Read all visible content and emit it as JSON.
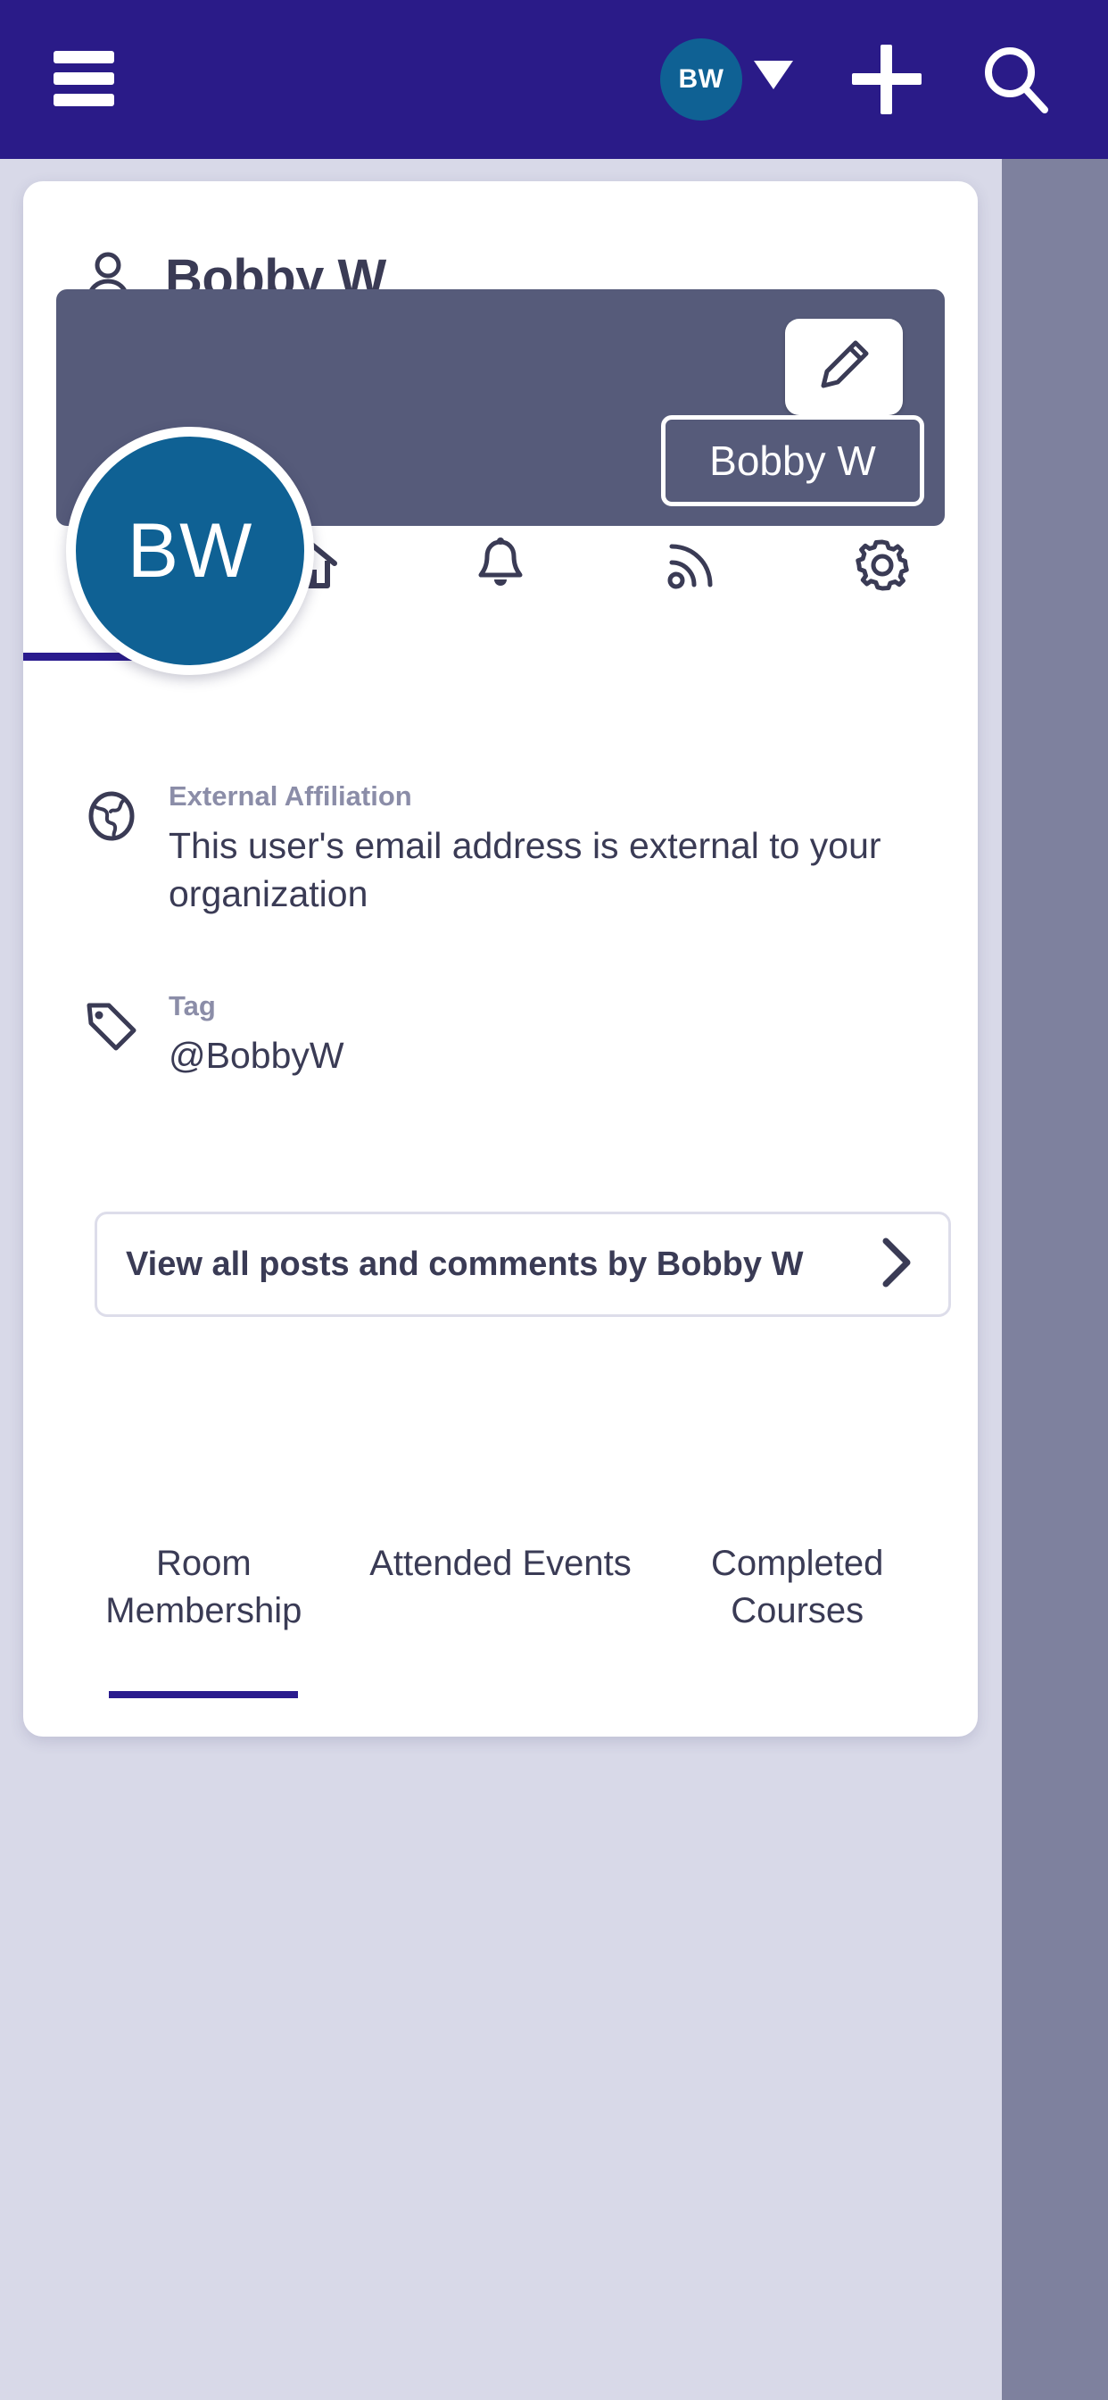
{
  "appbar": {
    "menu_icon": "hamburger-menu-icon",
    "avatar_initials": "BW",
    "caret_icon": "chevron-down-icon",
    "add_icon": "plus-icon",
    "search_icon": "search-icon",
    "background_color": "#2a1b88"
  },
  "card": {
    "title": "Bobby W",
    "title_icon": "person-icon",
    "icon_tabs": [
      {
        "name": "profile",
        "icon": "user-circle-icon",
        "active": true
      },
      {
        "name": "home",
        "icon": "home-icon",
        "active": false
      },
      {
        "name": "notifications",
        "icon": "bell-icon",
        "active": false
      },
      {
        "name": "feed",
        "icon": "rss-feed-icon",
        "active": false
      },
      {
        "name": "settings",
        "icon": "gear-icon",
        "active": false
      }
    ],
    "banner": {
      "background_color": "#565b7a",
      "edit_icon": "pencil-icon",
      "name_badge": "Bobby W"
    },
    "avatar": {
      "initials": "BW",
      "background_color": "#0f6194"
    },
    "info": {
      "affiliation": {
        "icon": "globe-icon",
        "label": "External Affiliation",
        "value": "This user's email address is external to your organization"
      },
      "tag": {
        "icon": "tag-icon",
        "label": "Tag",
        "value": "@BobbyW"
      }
    },
    "view_all_posts": {
      "label": "View all posts and comments by Bobby W",
      "chevron_icon": "chevron-right-icon"
    },
    "bottom_tabs": [
      {
        "label": "Room Membership",
        "active": true
      },
      {
        "label": "Attended Events",
        "active": false
      },
      {
        "label": "Completed Courses",
        "active": false
      }
    ]
  },
  "colors": {
    "page_background": "#d8d9e8",
    "side_strip": "#7e819e",
    "accent": "#2a1b8e",
    "text_primary": "#3a3b55",
    "text_muted": "#8b8da8"
  }
}
